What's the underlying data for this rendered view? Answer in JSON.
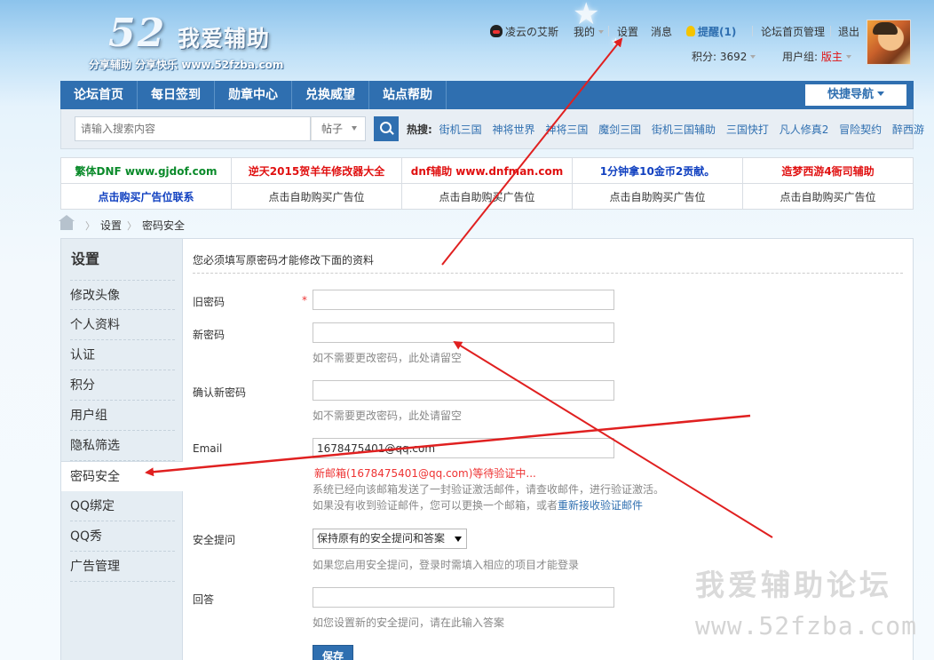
{
  "logo": {
    "number": "52",
    "name": "我爱辅助",
    "slogan": "分享辅助 分享快乐 www.52fzba.com"
  },
  "user_nav": {
    "username": "凌云の艾斯",
    "my": "我的",
    "settings": "设置",
    "messages": "消息",
    "reminders": "提醒(1)",
    "forum_admin": "论坛首页管理",
    "logout": "退出",
    "points_label": "积分: 3692",
    "usergroup_label": "用户组:",
    "usergroup_value": "版主"
  },
  "nav": {
    "items": [
      "论坛首页",
      "每日签到",
      "勋章中心",
      "兑换威望",
      "站点帮助"
    ],
    "quick_nav": "快捷导航"
  },
  "search": {
    "placeholder": "请输入搜索内容",
    "type": "帖子",
    "hot_label": "热搜:",
    "hot_items": [
      "街机三国",
      "神将世界",
      "神将三国",
      "魔剑三国",
      "街机三国辅助",
      "三国快打",
      "凡人修真2",
      "冒险契约",
      "醉西游"
    ]
  },
  "ads": {
    "row1": [
      "繁体DNF www.gjdof.com",
      "逆天2015贺羊年修改器大全",
      "dnf辅助 www.dnfman.com",
      "1分钟拿10金币2贡献。",
      "造梦西游4衙司辅助"
    ],
    "row2": [
      "点击购买广告位联系",
      "点击自助购买广告位",
      "点击自助购买广告位",
      "点击自助购买广告位",
      "点击自助购买广告位"
    ]
  },
  "breadcrumb": {
    "items": [
      "设置",
      "密码安全"
    ]
  },
  "sidebar": {
    "title": "设置",
    "items": [
      "修改头像",
      "个人资料",
      "认证",
      "积分",
      "用户组",
      "隐私筛选",
      "密码安全",
      "QQ绑定",
      "QQ秀",
      "广告管理"
    ],
    "active": "密码安全"
  },
  "form": {
    "notice": "您必须填写原密码才能修改下面的资料",
    "old_password_label": "旧密码",
    "required_mark": "*",
    "new_password_label": "新密码",
    "new_password_tip": "如不需要更改密码，此处请留空",
    "confirm_password_label": "确认新密码",
    "confirm_password_tip": "如不需要更改密码，此处请留空",
    "email_label": "Email",
    "email_value": "1678475401@qq.com",
    "email_pending": "新邮箱(1678475401@qq.com)等待验证中...",
    "email_tip1": "系统已经向该邮箱发送了一封验证激活邮件，请查收邮件，进行验证激活。",
    "email_tip2": "如果没有收到验证邮件，您可以更换一个邮箱，或者",
    "email_resend_link": "重新接收验证邮件",
    "security_question_label": "安全提问",
    "security_question_value": "保持原有的安全提问和答案",
    "security_question_tip": "如果您启用安全提问，登录时需填入相应的项目才能登录",
    "answer_label": "回答",
    "answer_tip": "如您设置新的安全提问，请在此输入答案",
    "save_button": "保存"
  },
  "watermark": {
    "line1": "我爱辅助论坛",
    "line2": "www.52fzba.com"
  },
  "colors": {
    "nav_blue": "#2f6fb0",
    "annotation_red": "#e02020",
    "warning_red": "#e33333"
  }
}
